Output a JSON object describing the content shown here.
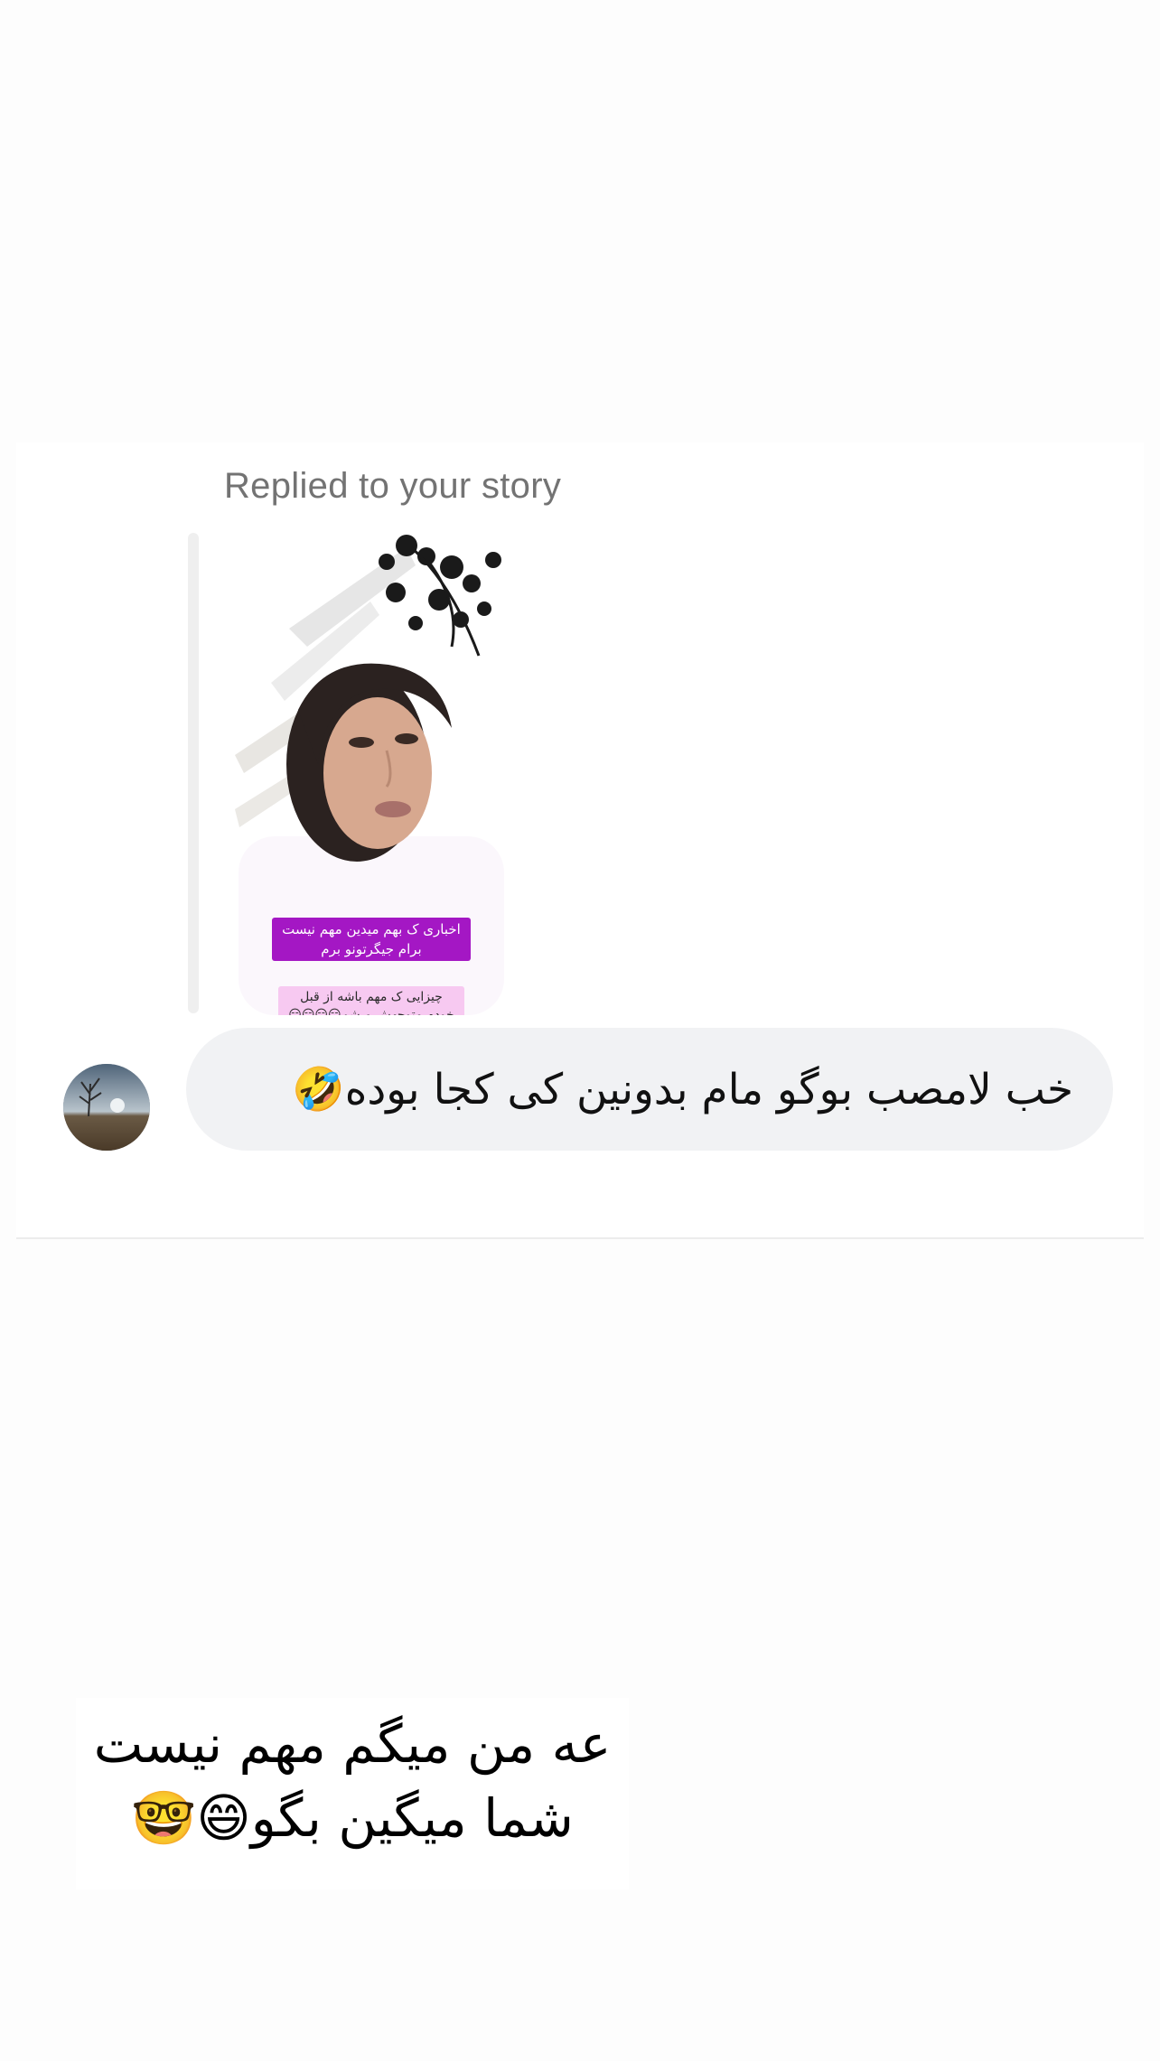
{
  "story_reply": {
    "label": "Replied to your story",
    "story": {
      "caption_primary": "اخباری ک بهم میدین مهم نیست برام جیگرتونو برم",
      "caption_secondary": "چیزایی ک مهم باشه از قبل خودم متوجهش میشم😏😏😏😏"
    },
    "message": "خب لامصب بوگو مام بدونین کی کجا بوده🤣"
  },
  "overlay_text": {
    "line1": "عه من میگم مهم نیست",
    "line2": "شما میگین بگو😄🤓"
  },
  "colors": {
    "background": "#fdfdfd",
    "bubble": "#f1f2f4",
    "label": "#737373",
    "caption_primary_bg": "#a417c4",
    "caption_secondary_bg": "#f7c9f1"
  }
}
